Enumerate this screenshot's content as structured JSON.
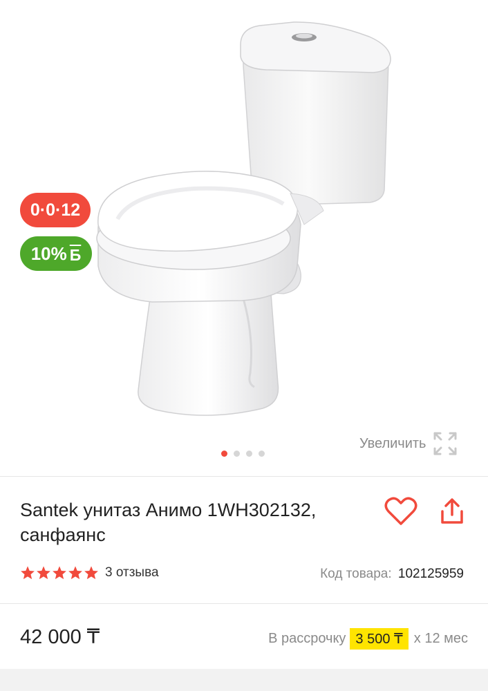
{
  "gallery": {
    "badges": {
      "installment": "0·0·12",
      "bonus_percent": "10%",
      "bonus_symbol": "Б"
    },
    "zoom_label": "Увеличить",
    "slide_count": 4,
    "active_slide": 1
  },
  "product": {
    "title": "Santek унитаз Анимо 1WH302132, санфаянс",
    "rating_stars": 5,
    "reviews": "3 отзыва",
    "sku_label": "Код товара:",
    "sku_value": "102125959",
    "price": "42 000 ₸",
    "installment_prefix": "В рассрочку",
    "installment_amount": "3 500 ₸",
    "installment_suffix": "x 12 мес"
  },
  "colors": {
    "accent_red": "#f14a3c",
    "bonus_green": "#4ea82a",
    "installment_yellow": "#ffe400"
  }
}
